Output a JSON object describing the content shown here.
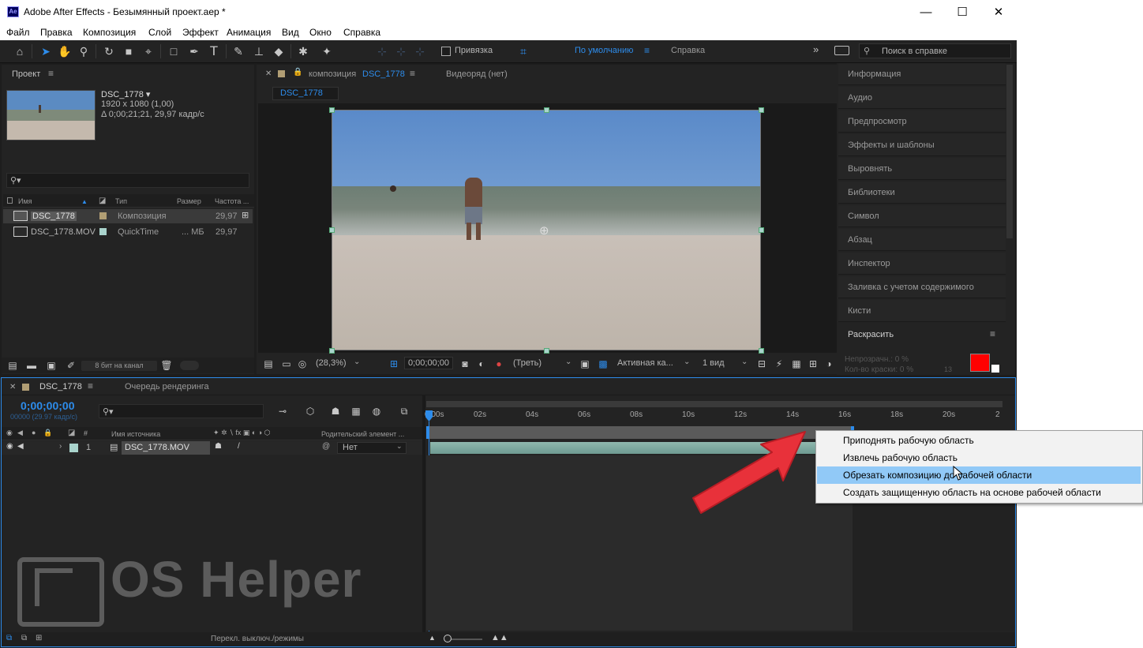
{
  "window": {
    "app_icon": "Ae",
    "title": "Adobe After Effects - Безымянный проект.aep *",
    "minimize_icon": "—",
    "maximize_icon": "☐",
    "close_icon": "✕"
  },
  "menu": [
    "Файл",
    "Правка",
    "Композиция",
    "Слой",
    "Эффект",
    "Анимация",
    "Вид",
    "Окно",
    "Справка"
  ],
  "toolbar": {
    "snap_label": "Привязка",
    "workspace_default": "По умолчанию",
    "workspace_help": "Справка",
    "search_placeholder": "Поиск в справке",
    "tools": [
      "home-icon",
      "selection-icon",
      "hand-icon",
      "zoom-icon",
      "rotate-icon",
      "camera-icon",
      "pan-behind-icon",
      "rectangle-icon",
      "pen-icon",
      "text-icon",
      "brush-icon",
      "clone-stamp-icon",
      "eraser-icon",
      "roto-brush-icon",
      "puppet-pin-icon"
    ]
  },
  "project": {
    "title": "Проект",
    "item_name": "DSC_1778 ▾",
    "item_res": "1920 x 1080 (1,00)",
    "item_dur": "Δ 0;00;21;21, 29,97 кадр/с",
    "search_placeholder": "⚲▾",
    "columns": {
      "name": "Имя",
      "type": "Тип",
      "size": "Размер",
      "fps": "Частота ..."
    },
    "rows": [
      {
        "name": "DSC_1778",
        "type": "Композиция",
        "size": "",
        "fps": "29,97",
        "color": "#b19e74"
      },
      {
        "name": "DSC_1778.MOV",
        "type": "QuickTime",
        "size": "... МБ",
        "fps": "29,97",
        "color": "#a9d3cc"
      }
    ],
    "bit_depth": "8 бит на канал"
  },
  "viewer": {
    "tab_label": "композиция",
    "tab_comp": "DSC_1778",
    "footage_tab": "Видеоряд (нет)",
    "comp_chip": "DSC_1778",
    "zoom": "(28,3%)",
    "timecode": "0;00;00;00",
    "resolution": "(Треть)",
    "camera": "Активная ка...",
    "views": "1 вид"
  },
  "right_panels": [
    "Информация",
    "Аудио",
    "Предпросмотр",
    "Эффекты и шаблоны",
    "Выровнять",
    "Библиотеки",
    "Символ",
    "Абзац",
    "Инспектор",
    "Заливка с учетом содержимого",
    "Кисти"
  ],
  "paint": {
    "title": "Раскрасить",
    "opacity": "Непрозрачн.: 0 %",
    "flow": "Кол-во краски: 0 %",
    "brush_size": "13",
    "fg_color": "#ff0000"
  },
  "timeline": {
    "tab": "DSC_1778",
    "render_queue": "Очередь рендеринга",
    "timecode": "0;00;00;00",
    "frames": "00000 (29.97 кадр/с)",
    "search_placeholder": "⚲▾",
    "source_col": "Имя источника",
    "parent_col": "Родительский элемент ...",
    "layer_num": "1",
    "layer_name": "DSC_1778.MOV",
    "parent_value": "Нет",
    "ticks": [
      "0:00s",
      "02s",
      "04s",
      "06s",
      "08s",
      "10s",
      "12s",
      "14s",
      "16s",
      "18s",
      "20s",
      "2"
    ],
    "footer_label": "Перекл. выключ./режимы"
  },
  "context_menu": {
    "items": [
      {
        "label": "Приподнять рабочую область",
        "highlighted": false
      },
      {
        "label": "Извлечь рабочую область",
        "highlighted": false
      },
      {
        "label": "Обрезать композицию до рабочей области",
        "highlighted": true
      },
      {
        "label": "Создать защищенную область на основе рабочей области",
        "highlighted": false
      }
    ]
  },
  "watermark": "OS Helper",
  "colors": {
    "accent": "#2d8ceb",
    "arrow": "#e8313a",
    "menu_highlight": "#91c9f7"
  }
}
